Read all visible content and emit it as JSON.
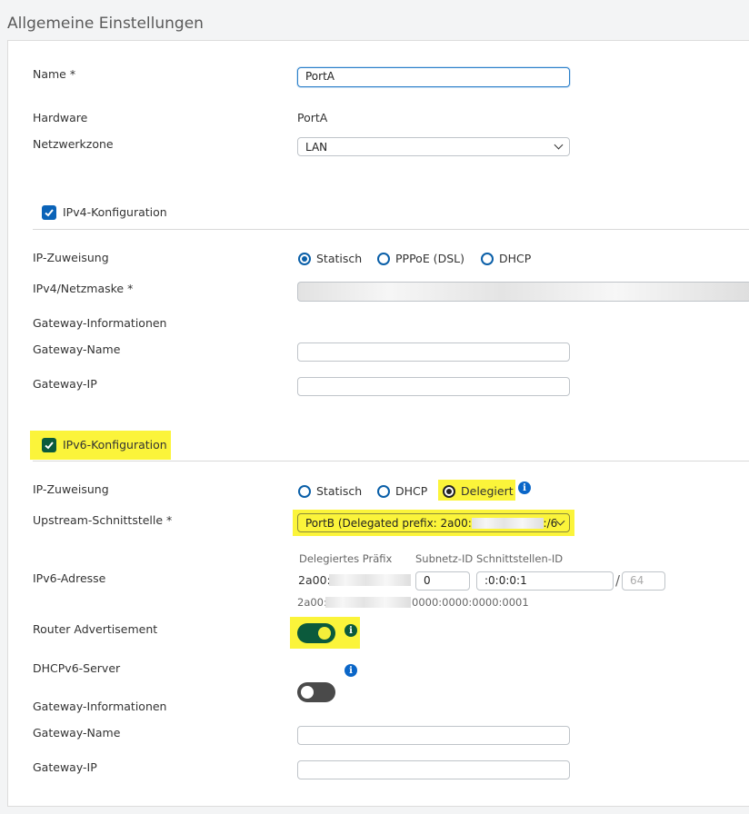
{
  "section_title": "Allgemeine Einstellungen",
  "general": {
    "name_label": "Name *",
    "name_value": "PortA",
    "hardware_label": "Hardware",
    "hardware_value": "PortA",
    "zone_label": "Netzwerkzone",
    "zone_value": "LAN"
  },
  "ipv4": {
    "checkbox_label": "IPv4-Konfiguration",
    "checked": true,
    "assignment_label": "IP-Zuweisung",
    "options": [
      "Statisch",
      "PPPoE (DSL)",
      "DHCP"
    ],
    "selected": "Statisch",
    "netmask_label": "IPv4/Netzmaske *",
    "gateway_info_label": "Gateway-Informationen",
    "gateway_name_label": "Gateway-Name",
    "gateway_ip_label": "Gateway-IP"
  },
  "ipv6": {
    "checkbox_label": "IPv6-Konfiguration",
    "checked": true,
    "assignment_label": "IP-Zuweisung",
    "options": [
      "Statisch",
      "DHCP",
      "Delegiert"
    ],
    "selected": "Delegiert",
    "upstream_label": "Upstream-Schnittstelle *",
    "upstream_value_start": "PortB (Delegated prefix: 2a00:",
    "upstream_value_end": ":/6",
    "address_label": "IPv6-Adresse",
    "col_prefix": "Delegiertes Präfix",
    "col_subnet": "Subnetz-ID",
    "col_interface": "Schnittstellen-ID",
    "prefix_value": "2a00:",
    "subnet_value": "0",
    "interface_value": ":0:0:0:1",
    "slash": "/",
    "prefix_length_placeholder": "64",
    "full_address_start": "2a00:",
    "full_address_end": "0000:0000:0000:0001",
    "router_adv_label": "Router Advertisement",
    "router_adv_on": true,
    "dhcpv6_label": "DHCPv6-Server",
    "dhcpv6_on": false,
    "gateway_info_label": "Gateway-Informationen",
    "gateway_name_label": "Gateway-Name",
    "gateway_ip_label": "Gateway-IP"
  },
  "icons": {
    "info": "i"
  },
  "colors": {
    "accent_blue": "#0a63b8",
    "highlight": "#fbf43a",
    "toggle_green": "#0b5a3c"
  }
}
